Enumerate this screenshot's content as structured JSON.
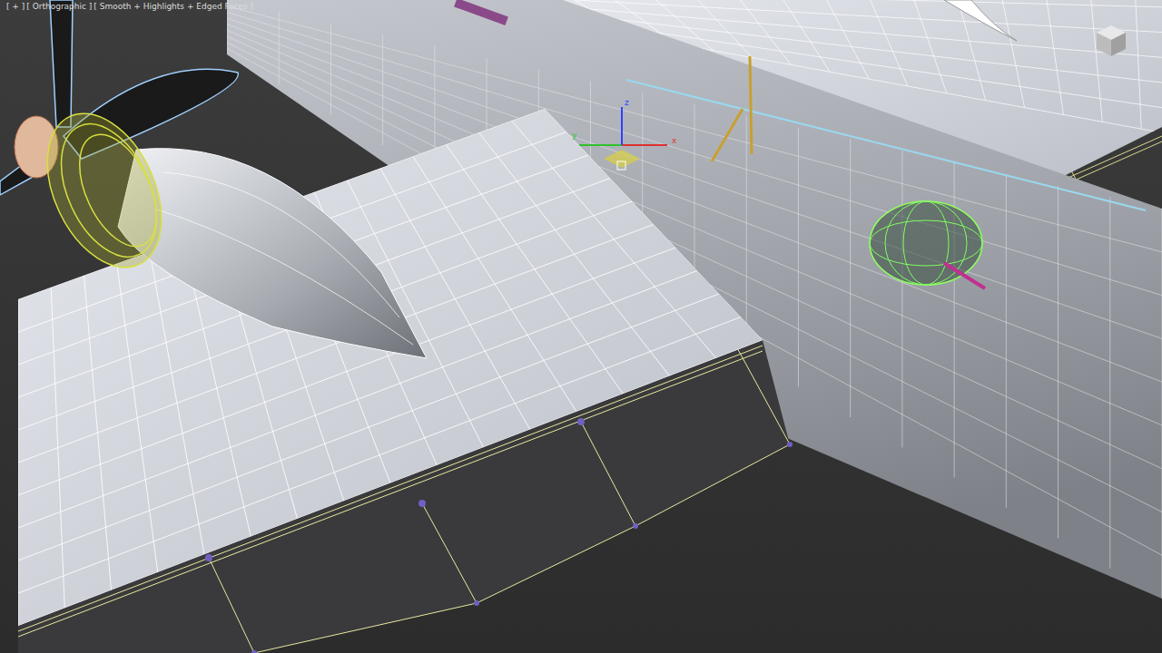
{
  "viewport": {
    "labels": [
      "[ + ]",
      "[ Orthographic ]",
      "[ Smooth + Highlights + Edged Faces ]"
    ]
  },
  "gizmo": {
    "axes": [
      {
        "label": "x",
        "color": "#e03030"
      },
      {
        "label": "y",
        "color": "#30c030"
      },
      {
        "label": "z",
        "color": "#3040ff"
      }
    ]
  }
}
